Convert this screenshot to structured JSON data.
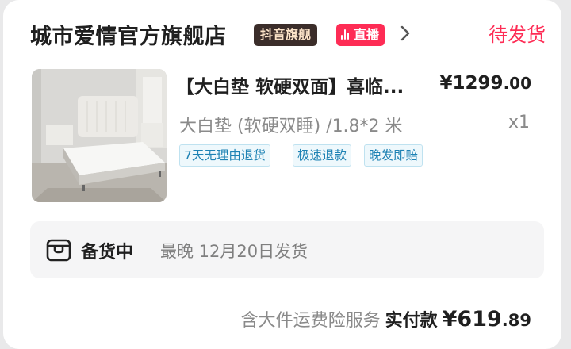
{
  "store": {
    "name": "城市爱情官方旗舰店",
    "flagship_badge": "抖音旗舰",
    "live_badge": "直播",
    "status": "待发货"
  },
  "product": {
    "title": "【大白垫 软硬双面】喜临...",
    "price_int": "¥1299",
    "price_dec": ".00",
    "spec": "大白垫 (软硬双睡) /1.8*2 米",
    "quantity": "x1",
    "tags": [
      "7天无理由退货",
      "极速退款",
      "晚发即赔"
    ]
  },
  "shipping": {
    "state": "备货中",
    "eta": "最晚 12月20日发货"
  },
  "footer": {
    "service": "含大件运费险服务",
    "paid_label": "实付款",
    "paid_int": "¥619",
    "paid_dec": ".89"
  },
  "colors": {
    "accent": "#fe2c55",
    "tag_text": "#1e82b4",
    "flagship_bg": "#3b2d2a"
  }
}
